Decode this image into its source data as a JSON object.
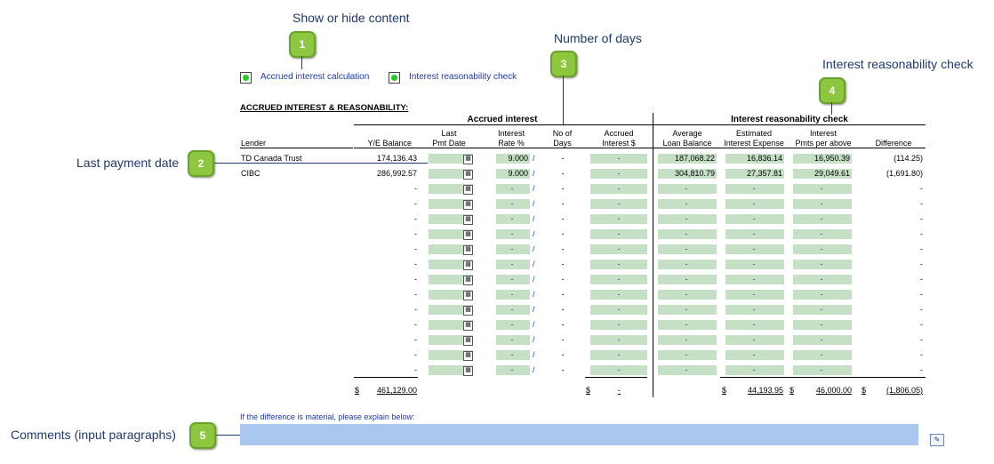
{
  "callouts": {
    "c1": {
      "num": "1",
      "label": "Show or hide content"
    },
    "c2": {
      "num": "2",
      "label": "Last payment date"
    },
    "c3": {
      "num": "3",
      "label": "Number of days"
    },
    "c4": {
      "num": "4",
      "label": "Interest reasonability check"
    },
    "c5": {
      "num": "5",
      "label": "Comments (input paragraphs)"
    }
  },
  "toggles": {
    "accrued": "Accrued interest calculation",
    "reasonability": "Interest reasonability check"
  },
  "section_title": "ACCRUED INTEREST & REASONABILITY:",
  "group_headers": {
    "accrued": "Accrued interest",
    "reasonability": "Interest reasonability check"
  },
  "headers": {
    "lender": "Lender",
    "ye_balance": "Y/E Balance",
    "last_pmt_1": "Last",
    "last_pmt_2": "Pmt Date",
    "rate_1": "Interest",
    "rate_2": "Rate %",
    "days_1": "No of",
    "days_2": "Days",
    "accrued_1": "Accrued",
    "accrued_2": "Interest $",
    "avg_1": "Average",
    "avg_2": "Loan Balance",
    "est_1": "Estimated",
    "est_2": "Interest Expense",
    "pmts_1": "Interest",
    "pmts_2": "Pmts per above",
    "diff": "Difference"
  },
  "rows": [
    {
      "lender": "TD Canada Trust",
      "ye": "174,136.43",
      "rate": "9.000",
      "slash": "/",
      "days": "-",
      "accrued": "-",
      "avg": "187,068.22",
      "est": "16,836.14",
      "pmts": "16,950.39",
      "diff": "(114.25)"
    },
    {
      "lender": "CIBC",
      "ye": "286,992.57",
      "rate": "9.000",
      "slash": "/",
      "days": "-",
      "accrued": "-",
      "avg": "304,810.79",
      "est": "27,357.81",
      "pmts": "29,049.61",
      "diff": "(1,691.80)"
    }
  ],
  "empty_value": "-",
  "empty_slash": "/",
  "empty_row_count": 13,
  "totals": {
    "ye_dollar": "$",
    "ye": "461,129.00",
    "accrued_dollar": "$",
    "accrued": "-",
    "est_dollar": "$",
    "est": "44,193.95",
    "pmts_dollar": "$",
    "pmts": "46,000.00",
    "diff_dollar": "$",
    "diff": "(1,806.05)"
  },
  "comment_prompt": "If the difference is material,  please explain below:",
  "icons": {
    "calendar": "calendar-icon",
    "edit": "edit-paragraph-icon",
    "check": "green-check-toggle-icon"
  },
  "colors": {
    "input_green": "#c6e0c6",
    "comment_blue": "#a9c7ef",
    "bubble_green": "#8dc63f",
    "label_blue": "#1f3aa6"
  }
}
